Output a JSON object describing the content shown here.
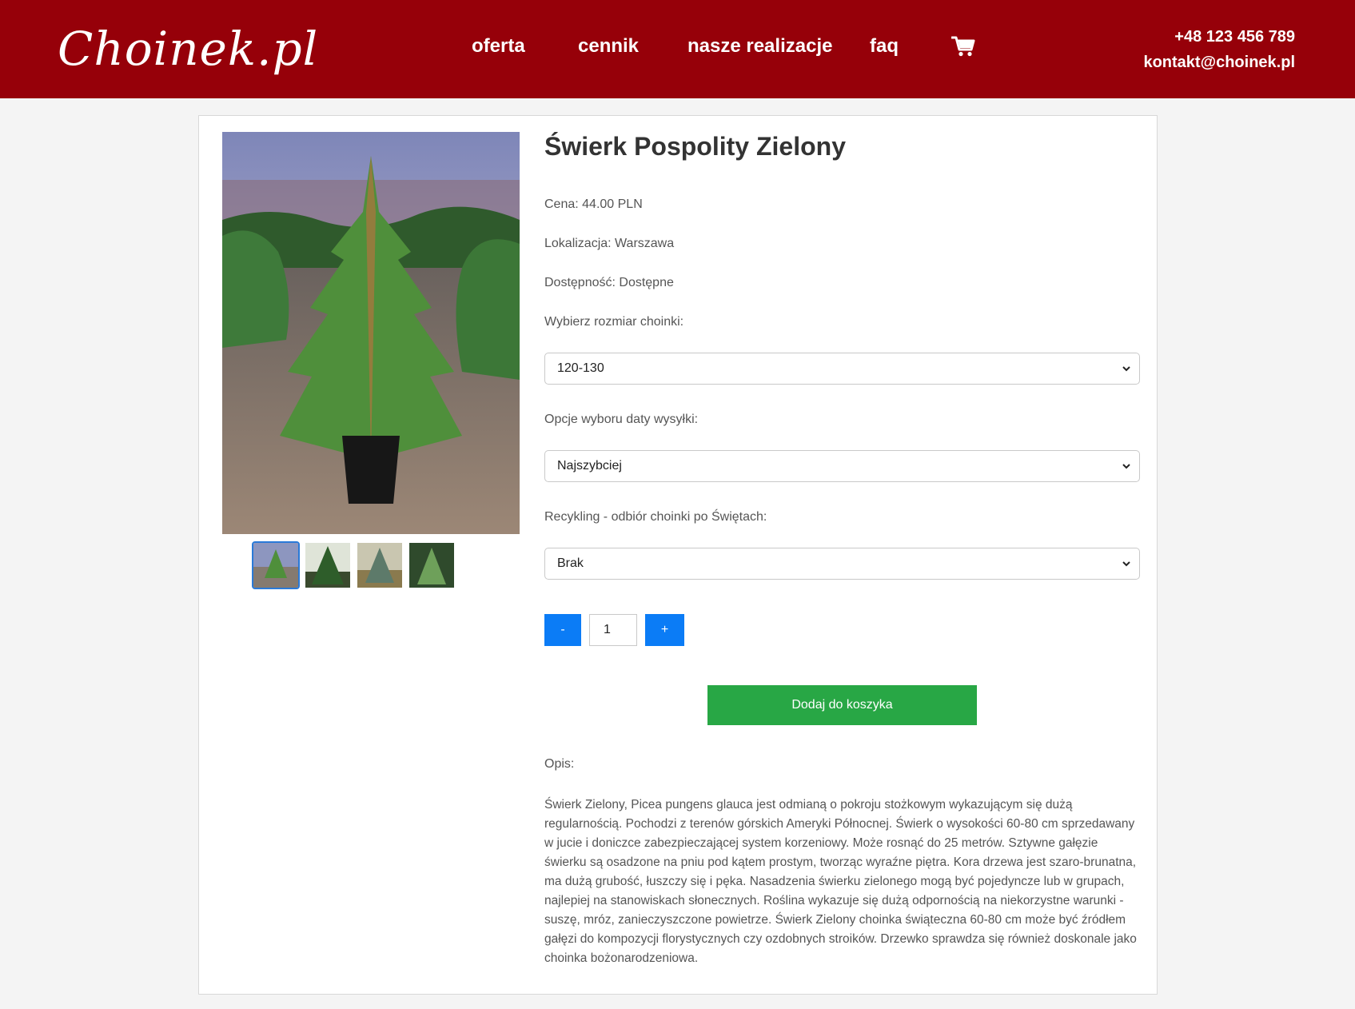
{
  "header": {
    "logo": "Choinek.pl",
    "nav": [
      "oferta",
      "cennik",
      "nasze realizacje",
      "faq"
    ],
    "cart_icon": "shopping-cart-icon",
    "phone": "+48 123 456 789",
    "email": "kontakt@choinek.pl"
  },
  "product": {
    "title": "Świerk Pospolity Zielony",
    "price": "Cena: 44.00 PLN",
    "location": "Lokalizacja: Warszawa",
    "availability": "Dostępność: Dostępne",
    "size_label": "Wybierz rozmiar choinki:",
    "size_selected": "120-130",
    "shipping_label": "Opcje wyboru daty wysyłki:",
    "shipping_selected": "Najszybciej",
    "recycling_label": "Recykling - odbiór choinki po Świętach:",
    "recycling_selected": "Brak",
    "qty_minus": "-",
    "qty_value": "1",
    "qty_plus": "+",
    "add_to_cart": "Dodaj do koszyka",
    "description_label": "Opis:",
    "description": "Świerk Zielony, Picea pungens glauca jest odmianą o pokroju stożkowym wykazującym się dużą regularnością. Pochodzi z terenów górskich Ameryki Północnej. Świerk o wysokości 60-80 cm sprzedawany w jucie i doniczce zabezpieczającej system korzeniowy. Może rosnąć do 25 metrów. Sztywne gałęzie świerku są osadzone na pniu pod kątem prostym, tworząc wyraźne piętra. Kora drzewa jest szaro-brunatna, ma dużą grubość, łuszczy się i pęka. Nasadzenia świerku zielonego mogą być pojedyncze lub w grupach, najlepiej na stanowiskach słonecznych. Roślina wykazuje się dużą odpornością na niekorzystne warunki - suszę, mróz, zanieczyszczone powietrze. Świerk Zielony choinka świąteczna 60-80 cm może być źródłem gałęzi do kompozycji florystycznych czy ozdobnych stroików. Drzewko sprawdza się również doskonale jako choinka bożonarodzeniowa.",
    "thumbnail_count": 4,
    "active_thumbnail": 1
  }
}
